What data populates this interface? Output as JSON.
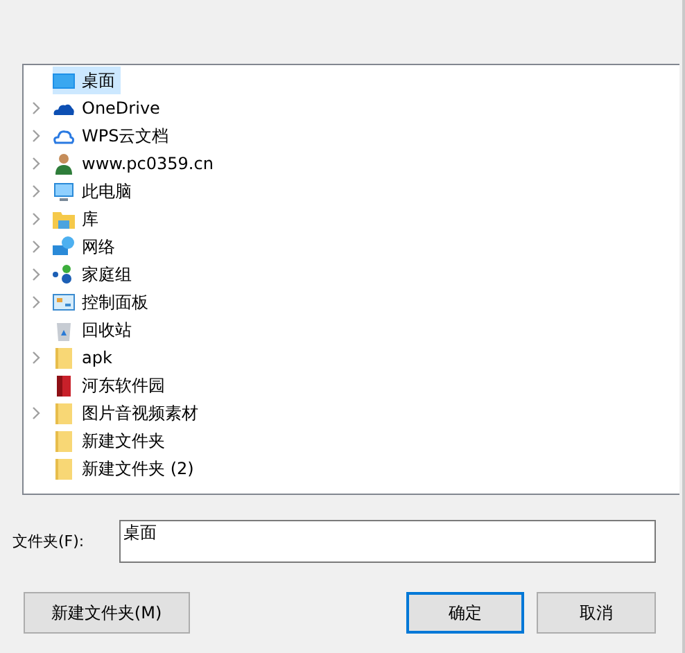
{
  "tree": {
    "items": [
      {
        "label": "桌面",
        "kind": "desktop",
        "expandable": false,
        "selected": true
      },
      {
        "label": "OneDrive",
        "kind": "cloud-filled",
        "expandable": true,
        "selected": false
      },
      {
        "label": "WPS云文档",
        "kind": "cloud-outline",
        "expandable": true,
        "selected": false
      },
      {
        "label": "www.pc0359.cn",
        "kind": "user",
        "expandable": true,
        "selected": false
      },
      {
        "label": "此电脑",
        "kind": "monitor",
        "expandable": true,
        "selected": false
      },
      {
        "label": "库",
        "kind": "library",
        "expandable": true,
        "selected": false
      },
      {
        "label": "网络",
        "kind": "network",
        "expandable": true,
        "selected": false
      },
      {
        "label": "家庭组",
        "kind": "homegroup",
        "expandable": true,
        "selected": false
      },
      {
        "label": "控制面板",
        "kind": "control-panel",
        "expandable": true,
        "selected": false
      },
      {
        "label": "回收站",
        "kind": "recycle-bin",
        "expandable": false,
        "selected": false
      },
      {
        "label": "apk",
        "kind": "folder",
        "expandable": true,
        "selected": false
      },
      {
        "label": "河东软件园",
        "kind": "book",
        "expandable": false,
        "selected": false
      },
      {
        "label": "图片音视频素材",
        "kind": "folder",
        "expandable": true,
        "selected": false
      },
      {
        "label": "新建文件夹",
        "kind": "folder",
        "expandable": false,
        "selected": false
      },
      {
        "label": "新建文件夹 (2)",
        "kind": "folder",
        "expandable": false,
        "selected": false
      }
    ]
  },
  "folder_field": {
    "label": "文件夹(F):",
    "value": "桌面"
  },
  "buttons": [
    {
      "label": "新建文件夹(M)",
      "default": false
    },
    {
      "label": "确定",
      "default": true
    },
    {
      "label": "取消",
      "default": false
    }
  ]
}
